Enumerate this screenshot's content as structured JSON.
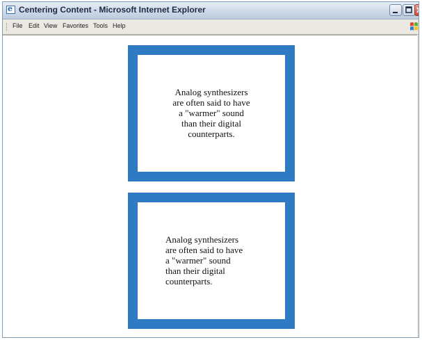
{
  "window": {
    "title": "Centering Content - Microsoft Internet Explorer",
    "icon": "ie-logo-icon"
  },
  "menubar": {
    "items": [
      "File",
      "Edit",
      "View",
      "Favorites",
      "Tools",
      "Help"
    ]
  },
  "content": {
    "box_centered": {
      "lines": [
        "Analog synthesizers",
        "are often said to have",
        "a \"warmer\" sound",
        "than their digital",
        "counterparts."
      ],
      "alignment": "center"
    },
    "box_left": {
      "lines": [
        "Analog synthesizers",
        "are often said to have",
        "a \"warmer\" sound",
        "than their digital",
        "counterparts."
      ],
      "alignment": "left"
    }
  },
  "colors": {
    "box_border": "#2e7bc4",
    "page_background": "#ffffff"
  }
}
